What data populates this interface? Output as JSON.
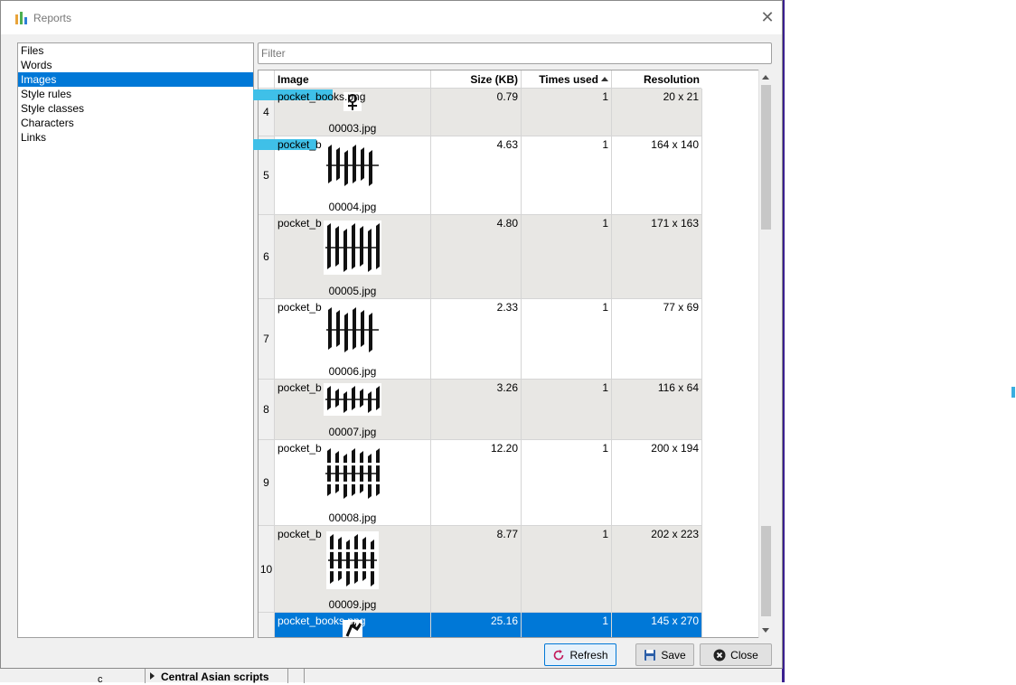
{
  "window": {
    "title": "Reports"
  },
  "left_list": {
    "items": [
      {
        "label": "Files",
        "selected": false
      },
      {
        "label": "Words",
        "selected": false
      },
      {
        "label": "Images",
        "selected": true
      },
      {
        "label": "Style rules",
        "selected": false
      },
      {
        "label": "Style classes",
        "selected": false
      },
      {
        "label": "Characters",
        "selected": false
      },
      {
        "label": "Links",
        "selected": false
      }
    ]
  },
  "filter": {
    "placeholder": "Filter",
    "value": ""
  },
  "table": {
    "columns": [
      "Image",
      "Size (KB)",
      "Times used",
      "Resolution"
    ],
    "sorted_column": "Times used",
    "rows": [
      {
        "num": "4",
        "name": "pocket_books.png",
        "file": "00003.jpg",
        "size": "0.79",
        "used": "1",
        "resolution": "20 x 21",
        "thumb": "symbol-icon"
      },
      {
        "num": "5",
        "name": "pocket_b",
        "file": "00004.jpg",
        "size": "4.63",
        "used": "1",
        "resolution": "164 x 140",
        "thumb": "ambigram-earth"
      },
      {
        "num": "6",
        "name": "pocket_b",
        "file": "00005.jpg",
        "size": "4.80",
        "used": "1",
        "resolution": "171 x 163",
        "thumb": "ambigram-air"
      },
      {
        "num": "7",
        "name": "pocket_b",
        "file": "00006.jpg",
        "size": "2.33",
        "used": "1",
        "resolution": "77 x 69",
        "thumb": "ambigram-fire"
      },
      {
        "num": "8",
        "name": "pocket_b",
        "file": "00007.jpg",
        "size": "3.26",
        "used": "1",
        "resolution": "116 x 64",
        "thumb": "ambigram-water"
      },
      {
        "num": "9",
        "name": "pocket_b",
        "file": "00008.jpg",
        "size": "12.20",
        "used": "1",
        "resolution": "200 x 194",
        "thumb": "ambigram-square"
      },
      {
        "num": "10",
        "name": "pocket_b",
        "file": "00009.jpg",
        "size": "8.77",
        "used": "1",
        "resolution": "202 x 223",
        "thumb": "ambigram-diamond"
      },
      {
        "num": "",
        "name": "pocket_books.png",
        "file": "",
        "size": "25.16",
        "used": "1",
        "resolution": "145 x 270",
        "thumb": "figure-icon"
      }
    ]
  },
  "buttons": {
    "refresh": "Refresh",
    "save": "Save",
    "close": "Close"
  },
  "background": {
    "tree_item": "Central Asian scripts",
    "c_label": "c"
  },
  "colors": {
    "selection": "#0078d7",
    "highlight": "#3fc0e8",
    "alt_row": "#e8e7e4"
  }
}
